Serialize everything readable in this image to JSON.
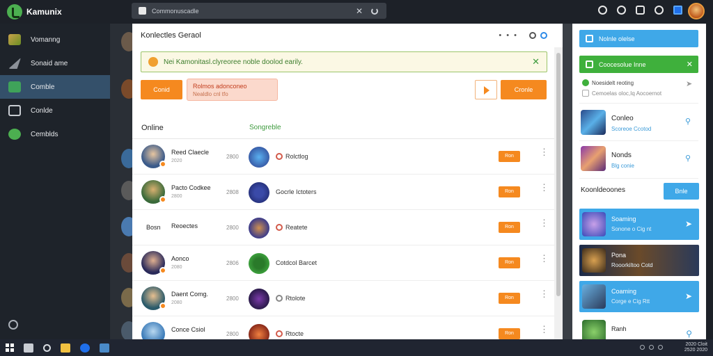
{
  "app": {
    "name": "Kamunix"
  },
  "search": {
    "text": "Commonuscadle"
  },
  "sidebar": {
    "items": [
      {
        "label": "Vomanng",
        "icon": "games-icon"
      },
      {
        "label": "Sonaid ame",
        "icon": "arrow-icon"
      },
      {
        "label": "Comble",
        "icon": "library-icon"
      },
      {
        "label": "Conlde",
        "icon": "window-icon"
      },
      {
        "label": "Cemblds",
        "icon": "community-icon"
      }
    ]
  },
  "main": {
    "title": "Konlectles Geraol",
    "alert": "Nei Kamonitasl.clyreoree noble doolod earily.",
    "button_left": "Conid",
    "pill_line1": "Rolmos adonconeo",
    "pill_line2": "Nealdlo cnl tfo",
    "button_right": "Cronle",
    "section_left": "Online",
    "section_right": "Songreble",
    "rows": [
      {
        "name": "Reed Claecle",
        "sub": "2020",
        "time": "2800",
        "game": "Rolctlog",
        "button": "Ron"
      },
      {
        "name": "Pacto Codkee",
        "sub": "2800",
        "time": "2808",
        "game": "Gocrle Ictoters",
        "button": "Ron"
      },
      {
        "name": "Reoectes",
        "sub": "",
        "time": "2800",
        "game": "Reatete",
        "button": "Ron",
        "label_left": "Bosn"
      },
      {
        "name": "Aonco",
        "sub": "2080",
        "time": "2806",
        "game": "Cotdcol Barcet",
        "button": "Ron"
      },
      {
        "name": "Daent Comg.",
        "sub": "2080",
        "time": "2800",
        "game": "Rtolote",
        "button": "Ron"
      },
      {
        "name": "Conce Csiol",
        "sub": "",
        "time": "2800",
        "game": "Rtocte",
        "button": "Ron"
      }
    ]
  },
  "right": {
    "blue_banner": "Nolnle olelse",
    "green_banner": "Coocesolue Inne",
    "check1": "Noesidelt reoting",
    "check2": "Cemoelas oloc,Iq Aocoernot",
    "friends": [
      {
        "name": "Conleo",
        "sub": "Scoreoe Ccotod"
      },
      {
        "name": "Nonds",
        "sub": "Blg conie"
      }
    ],
    "heading": "Koonldeoones",
    "heading_button": "Bnle",
    "cards": [
      {
        "title": "Soaming",
        "sub": "Sonone o Cig nt"
      },
      {
        "title": "Pona",
        "sub": "Rooorkiltoo Cotd"
      },
      {
        "title": "Coaming",
        "sub": "Corge e Cig Rtt"
      },
      {
        "title": "Ranh",
        "sub": ""
      }
    ]
  },
  "taskbar": {
    "time": "2020 Cloit",
    "date": "2520 2020"
  }
}
